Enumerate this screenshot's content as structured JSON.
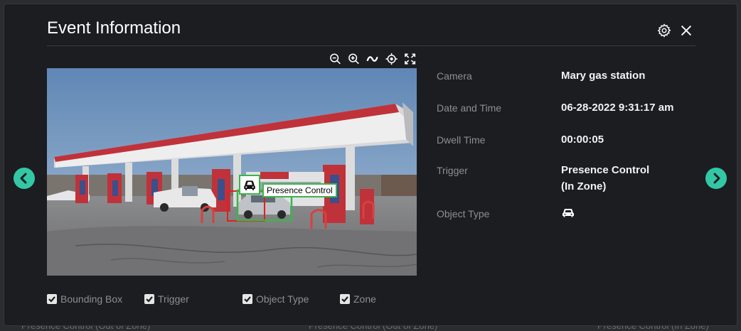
{
  "modal": {
    "title": "Event Information"
  },
  "header_icons": {
    "settings": "gear-icon",
    "close": "close-icon"
  },
  "toolbar": [
    "zoom-out-icon",
    "zoom-in-icon",
    "wave-icon",
    "crosshair-icon",
    "fullscreen-icon"
  ],
  "detection": {
    "label": "Presence Control",
    "box_color": "#3bb54a",
    "zone_color": "#e02020"
  },
  "info": {
    "camera_label": "Camera",
    "camera_value": "Mary gas station",
    "datetime_label": "Date and Time",
    "datetime_value": "06-28-2022 9:31:17 am",
    "dwell_label": "Dwell Time",
    "dwell_value": "00:00:05",
    "trigger_label": "Trigger",
    "trigger_value_line1": "Presence Control",
    "trigger_value_line2": "(In Zone)",
    "object_type_label": "Object Type",
    "object_type_icon": "car-icon"
  },
  "checkboxes": {
    "bounding_box": "Bounding Box",
    "trigger": "Trigger",
    "object_type": "Object Type",
    "zone": "Zone"
  },
  "backdrop": {
    "text1": "Presence Control (Out of Zone)",
    "text2": "Presence Control (Out of Zone)",
    "text3": "Presence Control (In Zone)"
  },
  "colors": {
    "accent": "#33c7a6",
    "modal_bg": "#1c1d21",
    "canopy_red": "#c0323a"
  }
}
